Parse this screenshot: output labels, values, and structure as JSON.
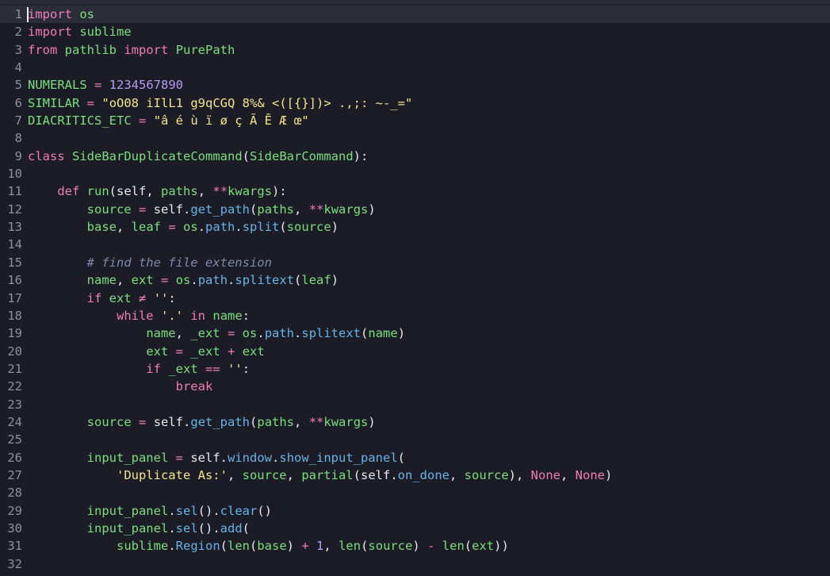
{
  "editor": {
    "lines": [
      {
        "n": "1",
        "current": true,
        "tokens": [
          [
            "kw",
            "import"
          ],
          [
            "ws",
            " "
          ],
          [
            "mod",
            "os"
          ]
        ]
      },
      {
        "n": "2",
        "tokens": [
          [
            "kw",
            "import"
          ],
          [
            "ws",
            " "
          ],
          [
            "mod",
            "sublime"
          ]
        ]
      },
      {
        "n": "3",
        "tokens": [
          [
            "kw",
            "from"
          ],
          [
            "ws",
            " "
          ],
          [
            "mod",
            "pathlib"
          ],
          [
            "ws",
            " "
          ],
          [
            "kw",
            "import"
          ],
          [
            "ws",
            " "
          ],
          [
            "cls",
            "PurePath"
          ]
        ]
      },
      {
        "n": "4",
        "tokens": []
      },
      {
        "n": "5",
        "tokens": [
          [
            "id",
            "NUMERALS"
          ],
          [
            "ws",
            " "
          ],
          [
            "op",
            "="
          ],
          [
            "ws",
            " "
          ],
          [
            "num",
            "1234567890"
          ]
        ]
      },
      {
        "n": "6",
        "tokens": [
          [
            "id",
            "SIMILAR"
          ],
          [
            "ws",
            " "
          ],
          [
            "op",
            "="
          ],
          [
            "ws",
            " "
          ],
          [
            "str",
            "\"oO08 iIlL1 g9qCGQ 8%& <([{}])> .,;: ~-_=\""
          ]
        ]
      },
      {
        "n": "7",
        "tokens": [
          [
            "id",
            "DIACRITICS_ETC"
          ],
          [
            "ws",
            " "
          ],
          [
            "op",
            "="
          ],
          [
            "ws",
            " "
          ],
          [
            "str",
            "\"â é ù ï ø ç Ã Ē Æ œ\""
          ]
        ]
      },
      {
        "n": "8",
        "tokens": []
      },
      {
        "n": "9",
        "tokens": [
          [
            "kw",
            "class"
          ],
          [
            "ws",
            " "
          ],
          [
            "cls",
            "SideBarDuplicateCommand"
          ],
          [
            "punc",
            "("
          ],
          [
            "cls",
            "SideBarCommand"
          ],
          [
            "punc",
            "):"
          ]
        ]
      },
      {
        "n": "10",
        "tokens": []
      },
      {
        "n": "11",
        "tokens": [
          [
            "ws",
            "    "
          ],
          [
            "kw",
            "def"
          ],
          [
            "ws",
            " "
          ],
          [
            "fn",
            "run"
          ],
          [
            "punc",
            "("
          ],
          [
            "self",
            "self"
          ],
          [
            "punc",
            ", "
          ],
          [
            "id",
            "paths"
          ],
          [
            "punc",
            ", "
          ],
          [
            "op",
            "**"
          ],
          [
            "id",
            "kwargs"
          ],
          [
            "punc",
            "):"
          ]
        ]
      },
      {
        "n": "12",
        "tokens": [
          [
            "ws",
            "        "
          ],
          [
            "id",
            "source"
          ],
          [
            "ws",
            " "
          ],
          [
            "op",
            "="
          ],
          [
            "ws",
            " "
          ],
          [
            "self",
            "self"
          ],
          [
            "punc",
            "."
          ],
          [
            "attr",
            "get_path"
          ],
          [
            "punc",
            "("
          ],
          [
            "id",
            "paths"
          ],
          [
            "punc",
            ", "
          ],
          [
            "op",
            "**"
          ],
          [
            "id",
            "kwargs"
          ],
          [
            "punc",
            ")"
          ]
        ]
      },
      {
        "n": "13",
        "tokens": [
          [
            "ws",
            "        "
          ],
          [
            "id",
            "base"
          ],
          [
            "punc",
            ", "
          ],
          [
            "id",
            "leaf"
          ],
          [
            "ws",
            " "
          ],
          [
            "op",
            "="
          ],
          [
            "ws",
            " "
          ],
          [
            "mod",
            "os"
          ],
          [
            "punc",
            "."
          ],
          [
            "attr",
            "path"
          ],
          [
            "punc",
            "."
          ],
          [
            "attr",
            "split"
          ],
          [
            "punc",
            "("
          ],
          [
            "id",
            "source"
          ],
          [
            "punc",
            ")"
          ]
        ]
      },
      {
        "n": "14",
        "tokens": []
      },
      {
        "n": "15",
        "tokens": [
          [
            "ws",
            "        "
          ],
          [
            "com",
            "# find the file extension"
          ]
        ]
      },
      {
        "n": "16",
        "tokens": [
          [
            "ws",
            "        "
          ],
          [
            "id",
            "name"
          ],
          [
            "punc",
            ", "
          ],
          [
            "id",
            "ext"
          ],
          [
            "ws",
            " "
          ],
          [
            "op",
            "="
          ],
          [
            "ws",
            " "
          ],
          [
            "mod",
            "os"
          ],
          [
            "punc",
            "."
          ],
          [
            "attr",
            "path"
          ],
          [
            "punc",
            "."
          ],
          [
            "attr",
            "splitext"
          ],
          [
            "punc",
            "("
          ],
          [
            "id",
            "leaf"
          ],
          [
            "punc",
            ")"
          ]
        ]
      },
      {
        "n": "17",
        "tokens": [
          [
            "ws",
            "        "
          ],
          [
            "kw",
            "if"
          ],
          [
            "ws",
            " "
          ],
          [
            "id",
            "ext"
          ],
          [
            "ws",
            " "
          ],
          [
            "op",
            "≠"
          ],
          [
            "ws",
            " "
          ],
          [
            "str",
            "''"
          ],
          [
            "punc",
            ":"
          ]
        ]
      },
      {
        "n": "18",
        "tokens": [
          [
            "ws",
            "            "
          ],
          [
            "kw",
            "while"
          ],
          [
            "ws",
            " "
          ],
          [
            "str",
            "'.'"
          ],
          [
            "ws",
            " "
          ],
          [
            "kw",
            "in"
          ],
          [
            "ws",
            " "
          ],
          [
            "id",
            "name"
          ],
          [
            "punc",
            ":"
          ]
        ]
      },
      {
        "n": "19",
        "tokens": [
          [
            "ws",
            "                "
          ],
          [
            "id",
            "name"
          ],
          [
            "punc",
            ", "
          ],
          [
            "id",
            "_ext"
          ],
          [
            "ws",
            " "
          ],
          [
            "op",
            "="
          ],
          [
            "ws",
            " "
          ],
          [
            "mod",
            "os"
          ],
          [
            "punc",
            "."
          ],
          [
            "attr",
            "path"
          ],
          [
            "punc",
            "."
          ],
          [
            "attr",
            "splitext"
          ],
          [
            "punc",
            "("
          ],
          [
            "id",
            "name"
          ],
          [
            "punc",
            ")"
          ]
        ]
      },
      {
        "n": "20",
        "tokens": [
          [
            "ws",
            "                "
          ],
          [
            "id",
            "ext"
          ],
          [
            "ws",
            " "
          ],
          [
            "op",
            "="
          ],
          [
            "ws",
            " "
          ],
          [
            "id",
            "_ext"
          ],
          [
            "ws",
            " "
          ],
          [
            "op",
            "+"
          ],
          [
            "ws",
            " "
          ],
          [
            "id",
            "ext"
          ]
        ]
      },
      {
        "n": "21",
        "tokens": [
          [
            "ws",
            "                "
          ],
          [
            "kw",
            "if"
          ],
          [
            "ws",
            " "
          ],
          [
            "id",
            "_ext"
          ],
          [
            "ws",
            " "
          ],
          [
            "op",
            "=="
          ],
          [
            "ws",
            " "
          ],
          [
            "str",
            "''"
          ],
          [
            "punc",
            ":"
          ]
        ]
      },
      {
        "n": "22",
        "tokens": [
          [
            "ws",
            "                    "
          ],
          [
            "kw",
            "break"
          ]
        ]
      },
      {
        "n": "23",
        "tokens": []
      },
      {
        "n": "24",
        "tokens": [
          [
            "ws",
            "        "
          ],
          [
            "id",
            "source"
          ],
          [
            "ws",
            " "
          ],
          [
            "op",
            "="
          ],
          [
            "ws",
            " "
          ],
          [
            "self",
            "self"
          ],
          [
            "punc",
            "."
          ],
          [
            "attr",
            "get_path"
          ],
          [
            "punc",
            "("
          ],
          [
            "id",
            "paths"
          ],
          [
            "punc",
            ", "
          ],
          [
            "op",
            "**"
          ],
          [
            "id",
            "kwargs"
          ],
          [
            "punc",
            ")"
          ]
        ]
      },
      {
        "n": "25",
        "tokens": []
      },
      {
        "n": "26",
        "tokens": [
          [
            "ws",
            "        "
          ],
          [
            "id",
            "input_panel"
          ],
          [
            "ws",
            " "
          ],
          [
            "op",
            "="
          ],
          [
            "ws",
            " "
          ],
          [
            "self",
            "self"
          ],
          [
            "punc",
            "."
          ],
          [
            "attr",
            "window"
          ],
          [
            "punc",
            "."
          ],
          [
            "attr",
            "show_input_panel"
          ],
          [
            "punc",
            "("
          ]
        ]
      },
      {
        "n": "27",
        "tokens": [
          [
            "ws",
            "            "
          ],
          [
            "str",
            "'Duplicate As:'"
          ],
          [
            "punc",
            ", "
          ],
          [
            "id",
            "source"
          ],
          [
            "punc",
            ", "
          ],
          [
            "fn",
            "partial"
          ],
          [
            "punc",
            "("
          ],
          [
            "self",
            "self"
          ],
          [
            "punc",
            "."
          ],
          [
            "attr",
            "on_done"
          ],
          [
            "punc",
            ", "
          ],
          [
            "id",
            "source"
          ],
          [
            "punc",
            "), "
          ],
          [
            "const",
            "None"
          ],
          [
            "punc",
            ", "
          ],
          [
            "const",
            "None"
          ],
          [
            "punc",
            ")"
          ]
        ]
      },
      {
        "n": "28",
        "tokens": []
      },
      {
        "n": "29",
        "tokens": [
          [
            "ws",
            "        "
          ],
          [
            "id",
            "input_panel"
          ],
          [
            "punc",
            "."
          ],
          [
            "attr",
            "sel"
          ],
          [
            "punc",
            "()."
          ],
          [
            "attr",
            "clear"
          ],
          [
            "punc",
            "()"
          ]
        ]
      },
      {
        "n": "30",
        "tokens": [
          [
            "ws",
            "        "
          ],
          [
            "id",
            "input_panel"
          ],
          [
            "punc",
            "."
          ],
          [
            "attr",
            "sel"
          ],
          [
            "punc",
            "()."
          ],
          [
            "attr",
            "add"
          ],
          [
            "punc",
            "("
          ]
        ]
      },
      {
        "n": "31",
        "tokens": [
          [
            "ws",
            "            "
          ],
          [
            "mod",
            "sublime"
          ],
          [
            "punc",
            "."
          ],
          [
            "attr",
            "Region"
          ],
          [
            "punc",
            "("
          ],
          [
            "fn",
            "len"
          ],
          [
            "punc",
            "("
          ],
          [
            "id",
            "base"
          ],
          [
            "punc",
            ")"
          ],
          [
            "ws",
            " "
          ],
          [
            "op",
            "+"
          ],
          [
            "ws",
            " "
          ],
          [
            "num",
            "1"
          ],
          [
            "punc",
            ", "
          ],
          [
            "fn",
            "len"
          ],
          [
            "punc",
            "("
          ],
          [
            "id",
            "source"
          ],
          [
            "punc",
            ")"
          ],
          [
            "ws",
            " "
          ],
          [
            "op",
            "-"
          ],
          [
            "ws",
            " "
          ],
          [
            "fn",
            "len"
          ],
          [
            "punc",
            "("
          ],
          [
            "id",
            "ext"
          ],
          [
            "punc",
            "))"
          ]
        ]
      },
      {
        "n": "32",
        "tokens": []
      }
    ]
  }
}
